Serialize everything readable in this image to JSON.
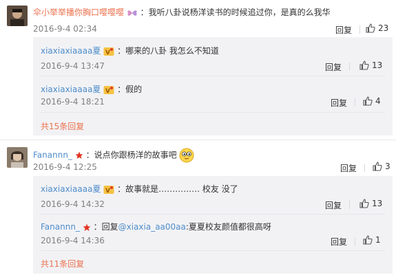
{
  "comments": [
    {
      "user": "伞小举举播你胸口嘤嘤嘤",
      "text": "：我听八卦说杨洋读书的时候追过你，是真的么我华",
      "date": "2016-9-4 02:34",
      "reply_label": "回复",
      "likes": "23",
      "sub_replies": [
        {
          "user": "xiaxiaxiaaaa夏",
          "text": "：哪来的八卦 我怎么不知道",
          "date": "2016-9-4 13:47",
          "reply_label": "回复",
          "likes": "13"
        },
        {
          "user": "xiaxiaxiaaaa夏",
          "text": "：假的",
          "date": "2016-9-4 18:21",
          "reply_label": "回复",
          "likes": "4"
        }
      ],
      "more_label": "共15条回复"
    },
    {
      "user": "Fanannn_",
      "text": "：说点你跟杨洋的故事吧",
      "date": "2016-9-4 12:25",
      "reply_label": "回复",
      "likes": "3",
      "sub_replies": [
        {
          "user": "xiaxiaxiaaaa夏",
          "text": "：故事就是…………… 校友 没了",
          "date": "2016-9-4 14:32",
          "reply_label": "回复",
          "likes": "13"
        },
        {
          "user": "Fanannn_",
          "text_prefix": "：回复",
          "mention": "@xiaxia_aa00aa",
          "text": ":夏夏校友颜值都很高呀",
          "date": "2016-9-4 14:36",
          "reply_label": "回复",
          "likes": "1"
        }
      ],
      "more_label": "共11条回复"
    }
  ],
  "colors": {
    "accent": "#eb7350",
    "link": "#4e8dc9",
    "sub_bg": "#f2f2f5",
    "muted": "#808080"
  }
}
